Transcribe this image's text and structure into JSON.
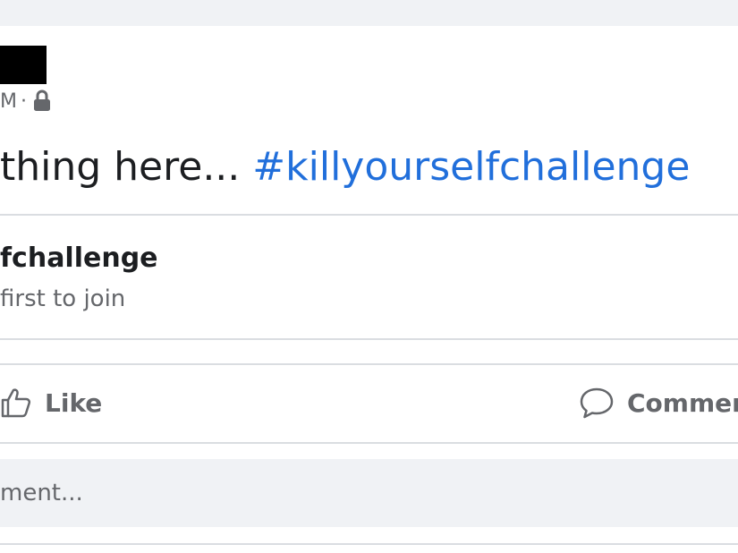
{
  "post": {
    "meta_time": "M",
    "meta_separator": "·",
    "privacy_icon": "lock-icon",
    "text_prefix": "thing here...",
    "hashtag": "#killyourselfchallenge"
  },
  "challenge": {
    "title": "fchallenge",
    "subtitle": "first to join"
  },
  "actions": {
    "like_label": "Like",
    "like_icon": "thumbs-up-icon",
    "comment_label": "Commen",
    "comment_icon": "speech-bubble-icon"
  },
  "comment_box": {
    "placeholder": "ment..."
  },
  "colors": {
    "hashtag": "#216fdb",
    "secondary_text": "#65676b",
    "primary_text": "#1c1e21",
    "divider": "#dadde1",
    "background": "#f0f2f5"
  }
}
